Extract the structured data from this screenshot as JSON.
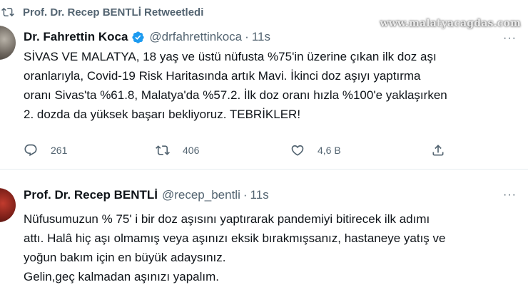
{
  "watermark": "www.malatyacagdas.com",
  "tweet1": {
    "retweet_label": "Prof. Dr. Recep BENTLİ Retweetledi",
    "author_name": "Dr. Fahrettin Koca",
    "handle": "@drfahrettinkoca",
    "separator": "·",
    "time": "11s",
    "more": "···",
    "lines": [
      "SİVAS VE MALATYA, 18 yaş ve üstü nüfusta %75'in üzerine çıkan ilk doz aşı",
      "oranlarıyla, Covid-19 Risk Haritasında artık Mavi. İkinci doz aşıyı yaptırma",
      "oranı Sivas'ta %61.8, Malatya'da %57.2. İlk doz oranı hızla %100'e yaklaşırken",
      "2. dozda da yüksek başarı bekliyoruz. TEBRİKLER!"
    ],
    "actions": {
      "replies": "261",
      "retweets": "406",
      "likes": "4,6 B"
    }
  },
  "tweet2": {
    "author_name": "Prof. Dr. Recep BENTLİ",
    "handle": "@recep_bentli",
    "separator": "·",
    "time": "11s",
    "more": "···",
    "lines": [
      "Nüfusumuzun % 75' i bir doz aşısını yaptırarak pandemiyi bitirecek ilk adımı",
      "attı. Halâ hiç aşı olmamış veya aşınızı eksik bırakmışsanız, hastaneye yatış ve",
      "yoğun bakım için en büyük adaysınız.",
      "Gelin,geç kalmadan aşınızı yapalım."
    ]
  },
  "colors": {
    "text_primary": "#0f1419",
    "text_secondary": "#536471",
    "verified_blue": "#1d9bf0",
    "separator": "#e6ecf0"
  }
}
